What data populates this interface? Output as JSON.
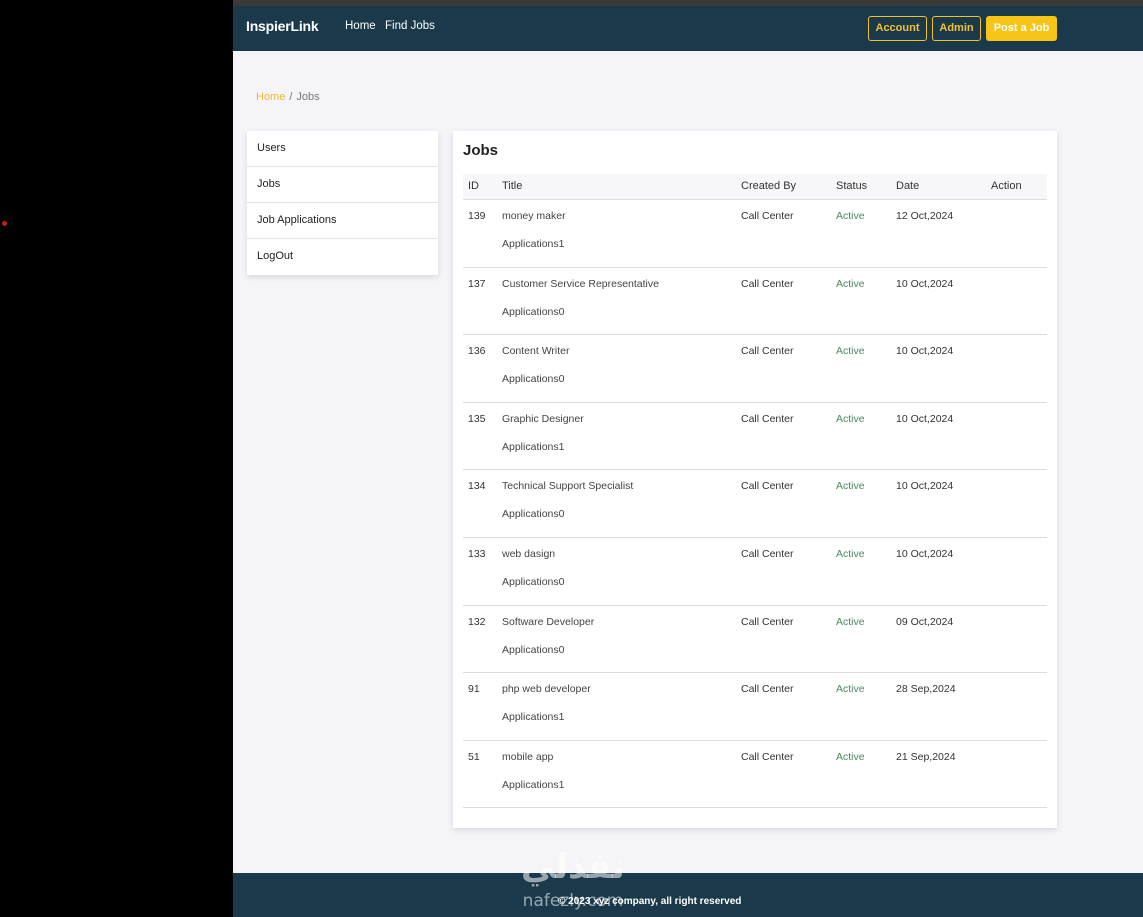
{
  "brand": "InspierLink",
  "nav": {
    "home": "Home",
    "find_jobs": "Find Jobs"
  },
  "buttons": {
    "account": "Account",
    "admin": "Admin",
    "post_job": "Post a Job"
  },
  "breadcrumb": {
    "home": "Home",
    "separator": "/",
    "current": "Jobs"
  },
  "sidebar": {
    "items": [
      {
        "label": "Users"
      },
      {
        "label": "Jobs"
      },
      {
        "label": "Job Applications"
      },
      {
        "label": "LogOut"
      }
    ]
  },
  "jobs": {
    "title": "Jobs",
    "columns": {
      "id": "ID",
      "title": "Title",
      "created_by": "Created By",
      "status": "Status",
      "date": "Date",
      "action": "Action"
    },
    "rows": [
      {
        "id": "139",
        "title": "money maker",
        "apps": "Applications1",
        "created_by": "Call Center",
        "status": "Active",
        "date": "12 Oct,2024"
      },
      {
        "id": "137",
        "title": "Customer Service Representative",
        "apps": "Applications0",
        "created_by": "Call Center",
        "status": "Active",
        "date": "10 Oct,2024"
      },
      {
        "id": "136",
        "title": "Content Writer",
        "apps": "Applications0",
        "created_by": "Call Center",
        "status": "Active",
        "date": "10 Oct,2024"
      },
      {
        "id": "135",
        "title": "Graphic Designer",
        "apps": "Applications1",
        "created_by": "Call Center",
        "status": "Active",
        "date": "10 Oct,2024"
      },
      {
        "id": "134",
        "title": "Technical Support Specialist",
        "apps": "Applications0",
        "created_by": "Call Center",
        "status": "Active",
        "date": "10 Oct,2024"
      },
      {
        "id": "133",
        "title": "web dasign",
        "apps": "Applications0",
        "created_by": "Call Center",
        "status": "Active",
        "date": "10 Oct,2024"
      },
      {
        "id": "132",
        "title": "Software Developer",
        "apps": "Applications0",
        "created_by": "Call Center",
        "status": "Active",
        "date": "09 Oct,2024"
      },
      {
        "id": "91",
        "title": "php web developer",
        "apps": "Applications1",
        "created_by": "Call Center",
        "status": "Active",
        "date": "28 Sep,2024"
      },
      {
        "id": "51",
        "title": "mobile app",
        "apps": "Applications1",
        "created_by": "Call Center",
        "status": "Active",
        "date": "21 Sep,2024"
      }
    ]
  },
  "footer": {
    "text": "© 2023 xyz company, all right reserved"
  },
  "watermark": {
    "arabic": "نفذلي",
    "latin": "nafezly.com"
  },
  "colors": {
    "navbar": "#1a3a4c",
    "accent": "#f2c12e",
    "status_active": "#4a8a5e",
    "background": "#f5f5f9"
  }
}
